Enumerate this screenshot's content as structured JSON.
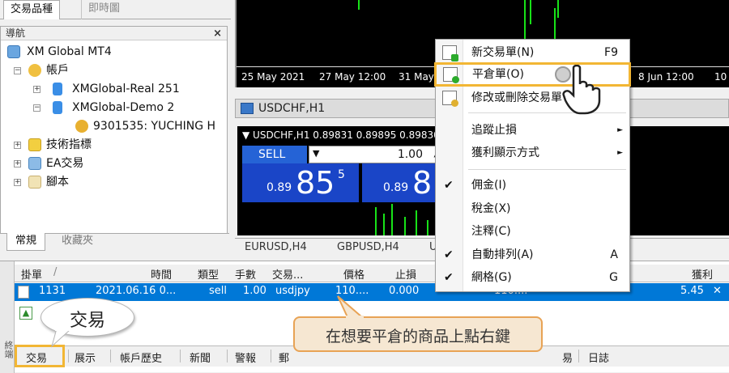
{
  "top_tabs": [
    "交易品種",
    "即時圖"
  ],
  "navigator": {
    "title": "導航",
    "close": "×",
    "root": "XM Global MT4",
    "accounts": "帳戶",
    "servers": [
      "XMGlobal-Real 251",
      "XMGlobal-Demo 2"
    ],
    "user": "9301535: YUCHING H",
    "indicators": "技術指標",
    "experts": "EA交易",
    "scripts": "腳本",
    "bottom_tabs": [
      "常規",
      "收藏夾"
    ]
  },
  "chart1": {
    "dates": [
      "25 May 2021",
      "27 May 12:00",
      "31 May",
      "8 Jun 12:00",
      "10"
    ]
  },
  "chart2": {
    "title": "USDCHF,H1",
    "info": "▼ USDCHF,H1  0.89831  0.89895  0.89830",
    "sell_label": "SELL",
    "lot": "1.00",
    "bid_prefix": "0.89",
    "bid_big": "85",
    "bid_small": "5",
    "ask_prefix": "0.89",
    "ask_big": "8"
  },
  "chart_tabs": [
    "EURUSD,H4",
    "GBPUSD,H4",
    "U"
  ],
  "terminal": {
    "headers": [
      "掛單",
      "/",
      "時間",
      "類型",
      "手數",
      "交易...",
      "價格",
      "止損",
      "獲利"
    ],
    "row": {
      "order": "1131",
      "time": "2021.06.16 0...",
      "type": "sell",
      "lots": "1.00",
      "symbol": "usdjpy",
      "price": "110....",
      "sl": "0.000",
      "extra": "110....",
      "profit": "5.45",
      "close": "✕"
    },
    "side_label": "終端",
    "tabs": [
      "交易",
      "展示",
      "帳戶歷史",
      "新聞",
      "警報",
      "郵",
      "易",
      "日誌"
    ]
  },
  "menu": {
    "items": [
      {
        "label": "新交易單(N)",
        "key": "F9"
      },
      {
        "label": "平倉單(O)",
        "key": ""
      },
      {
        "label": "修改或刪除交易單",
        "key": ""
      },
      {
        "label": "追蹤止損",
        "key": "►"
      },
      {
        "label": "獲利顯示方式",
        "key": "►"
      },
      {
        "label": "佣金(I)",
        "key": ""
      },
      {
        "label": "稅金(X)",
        "key": ""
      },
      {
        "label": "注釋(C)",
        "key": ""
      },
      {
        "label": "自動排列(A)",
        "key": "A"
      },
      {
        "label": "網格(G)",
        "key": "G"
      }
    ],
    "check": "✔"
  },
  "annotations": {
    "callout": "在想要平倉的商品上點右鍵",
    "bubble": "交易"
  },
  "colors": {
    "highlight": "#f2b634",
    "selected_row": "#0078d7",
    "chart_bg": "#000000",
    "candle": "#18e218",
    "sell_blue": "#1a45c7"
  }
}
